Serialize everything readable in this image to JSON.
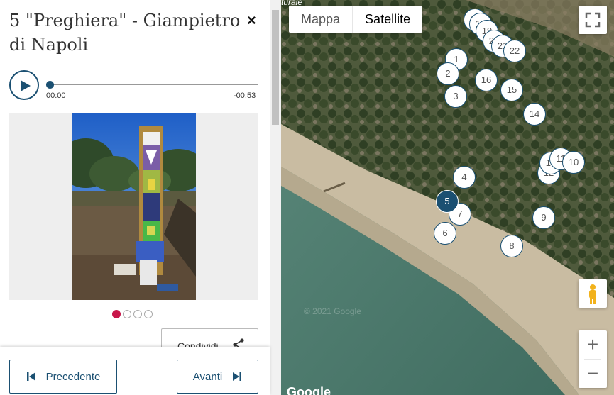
{
  "panel": {
    "title": "5 \"Preghiera\" - Giampietro di Napoli",
    "close_label": "×",
    "audio": {
      "current_time": "00:00",
      "remaining_time": "-00:53",
      "progress": 0
    },
    "carousel": {
      "count": 4,
      "active_index": 0,
      "active_color": "#c8174a"
    },
    "share_label": "Condividi",
    "prev_label": "Precedente",
    "next_label": "Avanti",
    "accent_color": "#1b5072"
  },
  "map": {
    "map_type_options": [
      "Mappa",
      "Satellite"
    ],
    "selected_map_type": "Satellite",
    "copyright": "© 2021 Google",
    "logo": "Google",
    "top_label": "turale",
    "zoom_in": "+",
    "zoom_out": "−",
    "markers": [
      {
        "label": "1",
        "active": false
      },
      {
        "label": "2",
        "active": false
      },
      {
        "label": "3",
        "active": false
      },
      {
        "label": "4",
        "active": false
      },
      {
        "label": "5",
        "active": true
      },
      {
        "label": "6",
        "active": false
      },
      {
        "label": "7",
        "active": false
      },
      {
        "label": "8",
        "active": false
      },
      {
        "label": "9",
        "active": false
      },
      {
        "label": "10",
        "active": false
      },
      {
        "label": "11",
        "active": false
      },
      {
        "label": "12",
        "active": false
      },
      {
        "label": "13",
        "active": false
      },
      {
        "label": "14",
        "active": false
      },
      {
        "label": "15",
        "active": false
      },
      {
        "label": "16",
        "active": false
      },
      {
        "label": "17",
        "active": false
      },
      {
        "label": "18",
        "active": false
      },
      {
        "label": "19",
        "active": false
      },
      {
        "label": "20",
        "active": false
      },
      {
        "label": "21",
        "active": false
      },
      {
        "label": "22",
        "active": false
      }
    ]
  }
}
